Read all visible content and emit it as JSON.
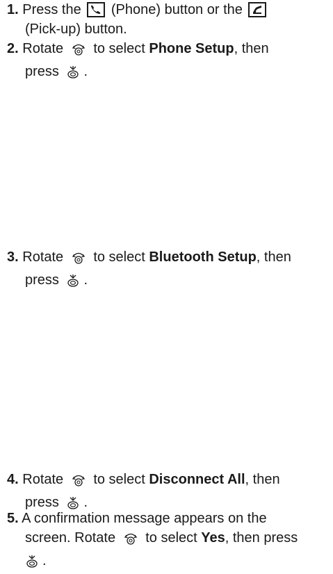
{
  "steps": [
    {
      "number": "1.",
      "line1_a": "Press the",
      "phone_icon_label": "(Phone)",
      "line1_b": "button or the",
      "line2": "(Pick-up) button."
    },
    {
      "number": "2.",
      "rotate_word": "Rotate",
      "select_text": "to select",
      "bold_item": "Phone Setup",
      "then_text": ", then",
      "press_word": "press",
      "period": "."
    },
    {
      "number": "3.",
      "rotate_word": "Rotate",
      "select_text": "to select",
      "bold_item": "Bluetooth Setup",
      "then_text": ", then",
      "press_word": "press",
      "period": "."
    },
    {
      "number": "4.",
      "rotate_word": "Rotate",
      "select_text": "to select",
      "bold_item": "Disconnect All",
      "then_text": ", then",
      "press_word": "press",
      "period": "."
    },
    {
      "number": "5.",
      "line1": "A confirmation message appears on the",
      "line2_a": "screen. Rotate",
      "select_text": "to select",
      "bold_item": "Yes",
      "line2_b": ", then press",
      "period": "."
    }
  ],
  "icons": {
    "phone": "phone-button-icon",
    "pickup": "pickup-button-icon",
    "rotate": "rotate-knob-icon",
    "press": "press-knob-icon"
  }
}
